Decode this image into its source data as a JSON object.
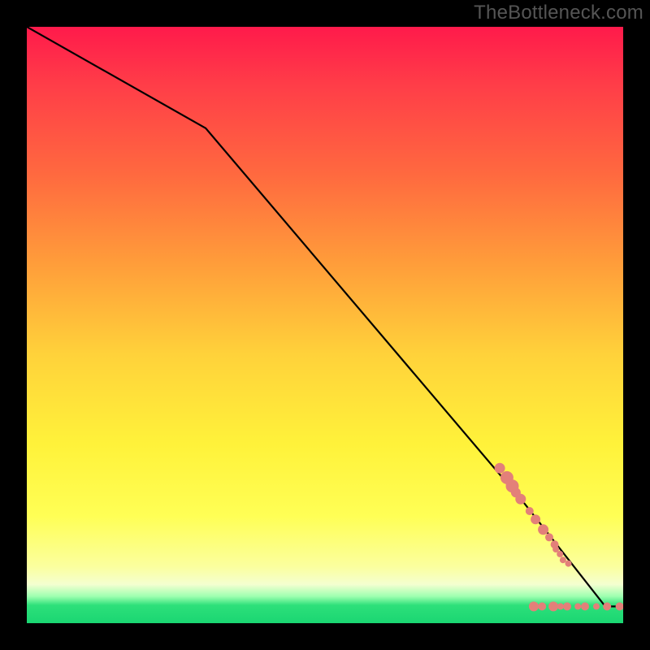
{
  "watermark": "TheBottleneck.com",
  "chart_data": {
    "type": "line",
    "title": "",
    "xlabel": "",
    "ylabel": "",
    "xlim": [
      0,
      100
    ],
    "ylim": [
      0,
      100
    ],
    "note": "Axes are unscaled (no ticks shown); values are percentage coordinates inside the colored plot area, origin at bottom-left.",
    "series": [
      {
        "name": "bottleneck-curve",
        "kind": "polyline",
        "x": [
          0,
          30,
          83.5,
          97,
          100
        ],
        "y_top": [
          0,
          17,
          80,
          97.2,
          97.2
        ],
        "comment": "y_top is measured from TOP of plot; y = 100 - y_top"
      }
    ],
    "points": {
      "name": "cluster",
      "color": "#e38079",
      "note": "salmon dots along and beyond the curve near bottom-right",
      "items": [
        {
          "x_pct": 79.3,
          "y_top_pct": 74.0,
          "r": 6.5
        },
        {
          "x_pct": 80.5,
          "y_top_pct": 75.6,
          "r": 8.0
        },
        {
          "x_pct": 81.4,
          "y_top_pct": 77.0,
          "r": 8.0
        },
        {
          "x_pct": 82.0,
          "y_top_pct": 78.1,
          "r": 6.0
        },
        {
          "x_pct": 82.8,
          "y_top_pct": 79.2,
          "r": 6.5
        },
        {
          "x_pct": 84.3,
          "y_top_pct": 81.2,
          "r": 5.0
        },
        {
          "x_pct": 85.3,
          "y_top_pct": 82.6,
          "r": 6.0
        },
        {
          "x_pct": 86.6,
          "y_top_pct": 84.3,
          "r": 6.5
        },
        {
          "x_pct": 87.6,
          "y_top_pct": 85.6,
          "r": 5.0
        },
        {
          "x_pct": 88.5,
          "y_top_pct": 86.8,
          "r": 5.0
        },
        {
          "x_pct": 88.7,
          "y_top_pct": 87.6,
          "r": 4.0
        },
        {
          "x_pct": 89.4,
          "y_top_pct": 88.4,
          "r": 4.0
        },
        {
          "x_pct": 89.9,
          "y_top_pct": 89.4,
          "r": 4.0
        },
        {
          "x_pct": 90.8,
          "y_top_pct": 90.0,
          "r": 4.0
        },
        {
          "x_pct": 85.0,
          "y_top_pct": 97.2,
          "r": 6.0
        },
        {
          "x_pct": 86.4,
          "y_top_pct": 97.2,
          "r": 5.0
        },
        {
          "x_pct": 88.3,
          "y_top_pct": 97.2,
          "r": 6.0
        },
        {
          "x_pct": 89.5,
          "y_top_pct": 97.2,
          "r": 4.0
        },
        {
          "x_pct": 90.6,
          "y_top_pct": 97.2,
          "r": 5.0
        },
        {
          "x_pct": 92.4,
          "y_top_pct": 97.2,
          "r": 4.0
        },
        {
          "x_pct": 93.6,
          "y_top_pct": 97.2,
          "r": 5.0
        },
        {
          "x_pct": 95.5,
          "y_top_pct": 97.2,
          "r": 4.0
        },
        {
          "x_pct": 97.3,
          "y_top_pct": 97.2,
          "r": 5.0
        },
        {
          "x_pct": 99.4,
          "y_top_pct": 97.2,
          "r": 5.0
        }
      ]
    },
    "background_gradient": {
      "direction": "top-to-bottom",
      "stops": [
        {
          "pct": 0,
          "color": "#ff1a4b"
        },
        {
          "pct": 25,
          "color": "#ff6a3f"
        },
        {
          "pct": 55,
          "color": "#ffd23a"
        },
        {
          "pct": 82,
          "color": "#ffff55"
        },
        {
          "pct": 97,
          "color": "#2de07a"
        },
        {
          "pct": 100,
          "color": "#1ad672"
        }
      ]
    }
  }
}
